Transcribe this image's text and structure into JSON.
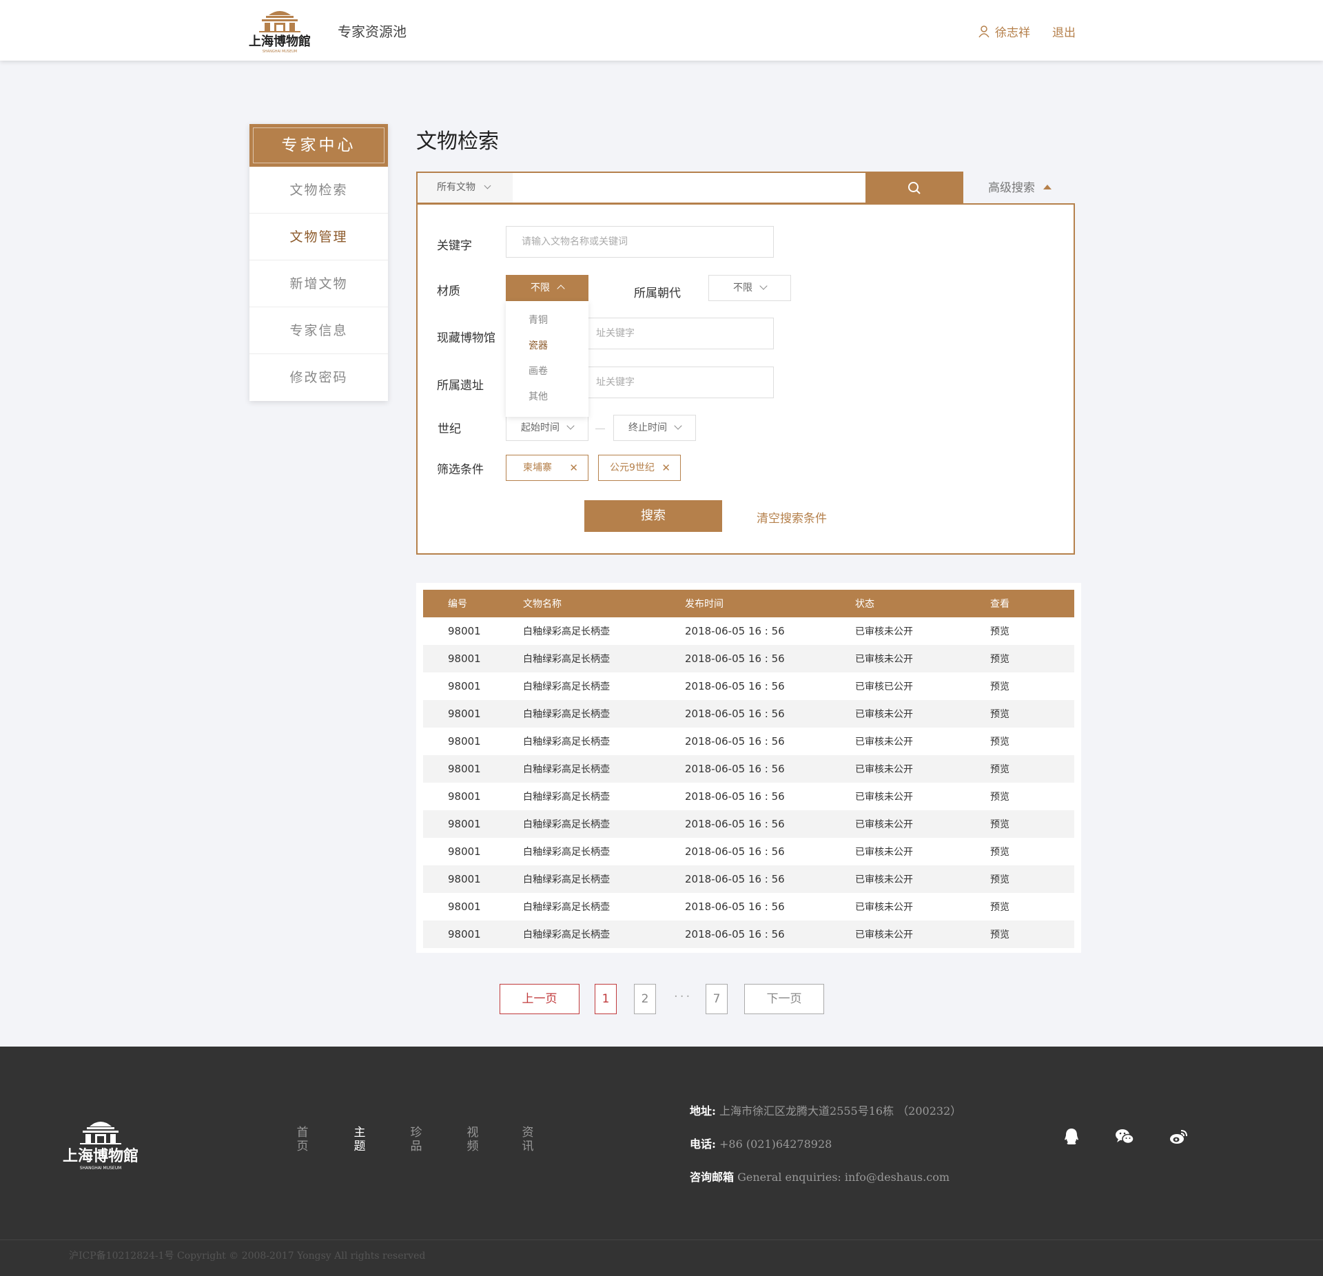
{
  "header": {
    "site_title": "专家资源池",
    "user_name": "徐志祥",
    "logout_label": "退出",
    "logo_text": "上海博物館",
    "logo_sub": "SHANGHAI MUSEUM"
  },
  "sidebar": {
    "title": "专家中心",
    "items": [
      {
        "label": "文物检索"
      },
      {
        "label": "文物管理"
      },
      {
        "label": "新增文物"
      },
      {
        "label": "专家信息"
      },
      {
        "label": "修改密码"
      }
    ]
  },
  "main": {
    "title": "文物检索",
    "search_scope": "所有文物",
    "advanced_label": "高级搜索"
  },
  "filters": {
    "keyword_label": "关键字",
    "keyword_placeholder": "请输入文物名称或关键词",
    "material_label": "材质",
    "material_value": "不限",
    "material_options": [
      "青铜",
      "瓷器",
      "画卷",
      "其他"
    ],
    "dynasty_label": "所属朝代",
    "dynasty_value": "不限",
    "museum_label": "现藏博物馆",
    "museum_placeholder": "址关键字",
    "site_label": "所属遗址",
    "site_placeholder": "址关键字",
    "century_label": "世纪",
    "start_time": "起始时间",
    "end_time": "终止时间",
    "conditions_label": "筛选条件",
    "tags": [
      "柬埔寨",
      "公元9世纪"
    ],
    "search_button": "搜索",
    "clear_label": "清空搜索条件"
  },
  "table": {
    "headers": [
      "编号",
      "文物名称",
      "发布时间",
      "状态",
      "查看"
    ],
    "rows": [
      [
        "98001",
        "白釉绿彩高足长柄壶",
        "2018-06-05 16 : 56",
        "已审核未公开",
        "预览"
      ],
      [
        "98001",
        "白釉绿彩高足长柄壶",
        "2018-06-05 16 : 56",
        "已审核未公开",
        "预览"
      ],
      [
        "98001",
        "白釉绿彩高足长柄壶",
        "2018-06-05 16 : 56",
        "已审核已公开",
        "预览"
      ],
      [
        "98001",
        "白釉绿彩高足长柄壶",
        "2018-06-05 16 : 56",
        "已审核未公开",
        "预览"
      ],
      [
        "98001",
        "白釉绿彩高足长柄壶",
        "2018-06-05 16 : 56",
        "已审核未公开",
        "预览"
      ],
      [
        "98001",
        "白釉绿彩高足长柄壶",
        "2018-06-05 16 : 56",
        "已审核未公开",
        "预览"
      ],
      [
        "98001",
        "白釉绿彩高足长柄壶",
        "2018-06-05 16 : 56",
        "已审核未公开",
        "预览"
      ],
      [
        "98001",
        "白釉绿彩高足长柄壶",
        "2018-06-05 16 : 56",
        "已审核未公开",
        "预览"
      ],
      [
        "98001",
        "白釉绿彩高足长柄壶",
        "2018-06-05 16 : 56",
        "已审核未公开",
        "预览"
      ],
      [
        "98001",
        "白釉绿彩高足长柄壶",
        "2018-06-05 16 : 56",
        "已审核未公开",
        "预览"
      ],
      [
        "98001",
        "白釉绿彩高足长柄壶",
        "2018-06-05 16 : 56",
        "已审核未公开",
        "预览"
      ],
      [
        "98001",
        "白釉绿彩高足长柄壶",
        "2018-06-05 16 : 56",
        "已审核未公开",
        "预览"
      ]
    ]
  },
  "pagination": {
    "prev": "上一页",
    "pages": [
      "1",
      "2",
      "7"
    ],
    "ellipsis": "···",
    "next": "下一页",
    "current": "1"
  },
  "footer": {
    "logo_text": "上海博物館",
    "logo_sub": "SHANGHAI MUSEUM",
    "nav": [
      "首页",
      "主题",
      "珍品",
      "视频",
      "资讯"
    ],
    "active_nav": "主题",
    "address_label": "地址:",
    "address": "上海市徐汇区龙腾大道2555号16栋 （200232）",
    "phone_label": "电话:",
    "phone": "+86 (021)64278928",
    "email_label": "咨询邮箱",
    "email": "General enquiries: info@deshaus.com",
    "social": [
      "qq-icon",
      "wechat-icon",
      "weibo-icon"
    ],
    "copyright": "沪ICP备10212824-1号 Copyright © 2008-2017 Yongsy All rights reserved"
  },
  "colors": {
    "accent": "#b5804b",
    "accent_dark": "#8c5a2b",
    "page_bg": "#f3f4f8",
    "footer_bg": "#333333",
    "pagination_active": "#c0393b"
  }
}
